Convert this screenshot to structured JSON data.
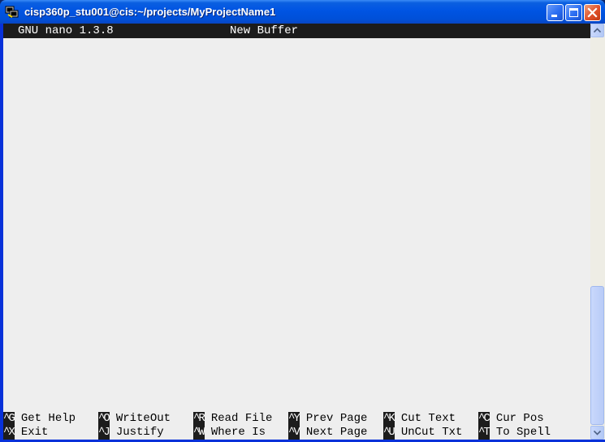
{
  "window": {
    "title": "cisp360p_stu001@cis:~/projects/MyProjectName1",
    "icon": "putty-terminal-icon",
    "controls": [
      "minimize-icon",
      "maximize-icon",
      "close-icon"
    ]
  },
  "nano": {
    "version": "GNU nano 1.3.8",
    "filename": "New Buffer"
  },
  "shortcuts": {
    "row1": [
      {
        "key": "^G",
        "label": "Get Help"
      },
      {
        "key": "^O",
        "label": "WriteOut"
      },
      {
        "key": "^R",
        "label": "Read File"
      },
      {
        "key": "^Y",
        "label": "Prev Page"
      },
      {
        "key": "^K",
        "label": "Cut Text"
      },
      {
        "key": "^C",
        "label": "Cur Pos"
      }
    ],
    "row2": [
      {
        "key": "^X",
        "label": "Exit"
      },
      {
        "key": "^J",
        "label": "Justify"
      },
      {
        "key": "^W",
        "label": "Where Is"
      },
      {
        "key": "^V",
        "label": "Next Page"
      },
      {
        "key": "^U",
        "label": "UnCut Txt"
      },
      {
        "key": "^T",
        "label": "To Spell"
      }
    ]
  },
  "colors": {
    "titlebar": "#0054e3",
    "terminal_inverse_bg": "#1c1c1c",
    "terminal_fg": "#000000",
    "close_button": "#e0502a"
  }
}
